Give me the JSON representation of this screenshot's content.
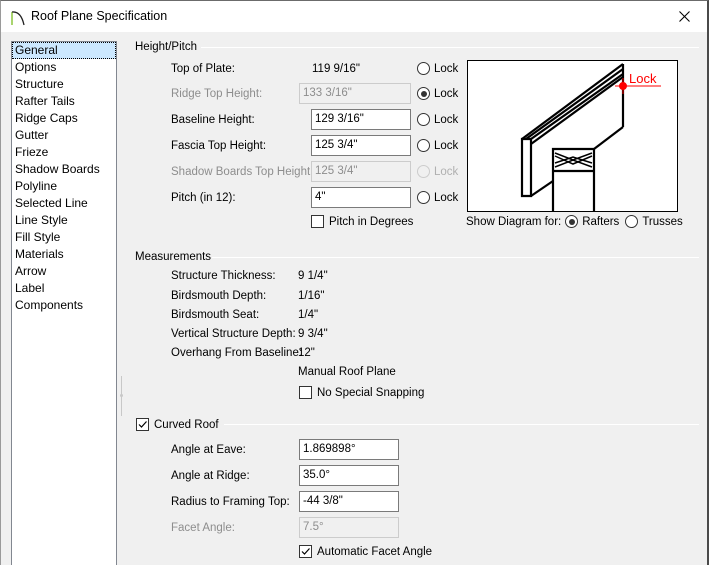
{
  "window": {
    "title": "Roof Plane Specification",
    "close_icon": "close-x-icon"
  },
  "sidebar": {
    "items": [
      {
        "label": "General",
        "selected": true
      },
      {
        "label": "Options"
      },
      {
        "label": "Structure"
      },
      {
        "label": "Rafter Tails"
      },
      {
        "label": "Ridge Caps"
      },
      {
        "label": "Gutter"
      },
      {
        "label": "Frieze"
      },
      {
        "label": "Shadow Boards"
      },
      {
        "label": "Polyline"
      },
      {
        "label": "Selected Line"
      },
      {
        "label": "Line Style"
      },
      {
        "label": "Fill Style"
      },
      {
        "label": "Materials"
      },
      {
        "label": "Arrow"
      },
      {
        "label": "Label"
      },
      {
        "label": "Components"
      }
    ]
  },
  "height_pitch": {
    "header": "Height/Pitch",
    "lock_label": "Lock",
    "top_of_plate": {
      "label": "Top of Plate:",
      "value": "119 9/16\"",
      "locked": false
    },
    "ridge_top_height": {
      "label": "Ridge Top Height:",
      "value": "133 3/16\"",
      "locked": true,
      "disabled": true
    },
    "baseline_height": {
      "label": "Baseline Height:",
      "value": "129 3/16\"",
      "locked": false
    },
    "fascia_top_height": {
      "label": "Fascia Top Height:",
      "value": "125 3/4\"",
      "locked": false
    },
    "shadow_boards_top_height": {
      "label": "Shadow Boards Top Height:",
      "value": "125 3/4\"",
      "locked": false,
      "disabled": true
    },
    "pitch": {
      "label": "Pitch (in 12):",
      "value": "4\"",
      "locked": false
    },
    "pitch_in_degrees": {
      "label": "Pitch in Degrees",
      "checked": false
    }
  },
  "diagram": {
    "lock_annotation": "Lock",
    "lock_color": "#ff0000",
    "show_for_label": "Show Diagram for:",
    "options": [
      {
        "label": "Rafters",
        "checked": true
      },
      {
        "label": "Trusses",
        "checked": false
      }
    ]
  },
  "measurements": {
    "header": "Measurements",
    "rows": [
      {
        "label": "Structure Thickness:",
        "value": "9 1/4\""
      },
      {
        "label": "Birdsmouth Depth:",
        "value": "1/16\""
      },
      {
        "label": "Birdsmouth Seat:",
        "value": "1/4\""
      },
      {
        "label": "Vertical Structure Depth:",
        "value": "9 3/4\""
      },
      {
        "label": "Overhang From Baseline:",
        "value": "12\""
      }
    ],
    "manual_roof_plane": "Manual Roof Plane",
    "no_special_snapping": {
      "label": "No Special Snapping",
      "checked": false
    }
  },
  "curved_roof": {
    "header": "Curved Roof",
    "checked": true,
    "angle_at_eave": {
      "label": "Angle at Eave:",
      "value": "1.869898°"
    },
    "angle_at_ridge": {
      "label": "Angle at Ridge:",
      "value": "35.0°"
    },
    "radius_to_framing_top": {
      "label": "Radius to Framing Top:",
      "value": "-44 3/8\""
    },
    "facet_angle": {
      "label": "Facet Angle:",
      "value": "7.5°",
      "disabled": true
    },
    "automatic_facet_angle": {
      "label": "Automatic Facet Angle",
      "checked": true
    }
  }
}
